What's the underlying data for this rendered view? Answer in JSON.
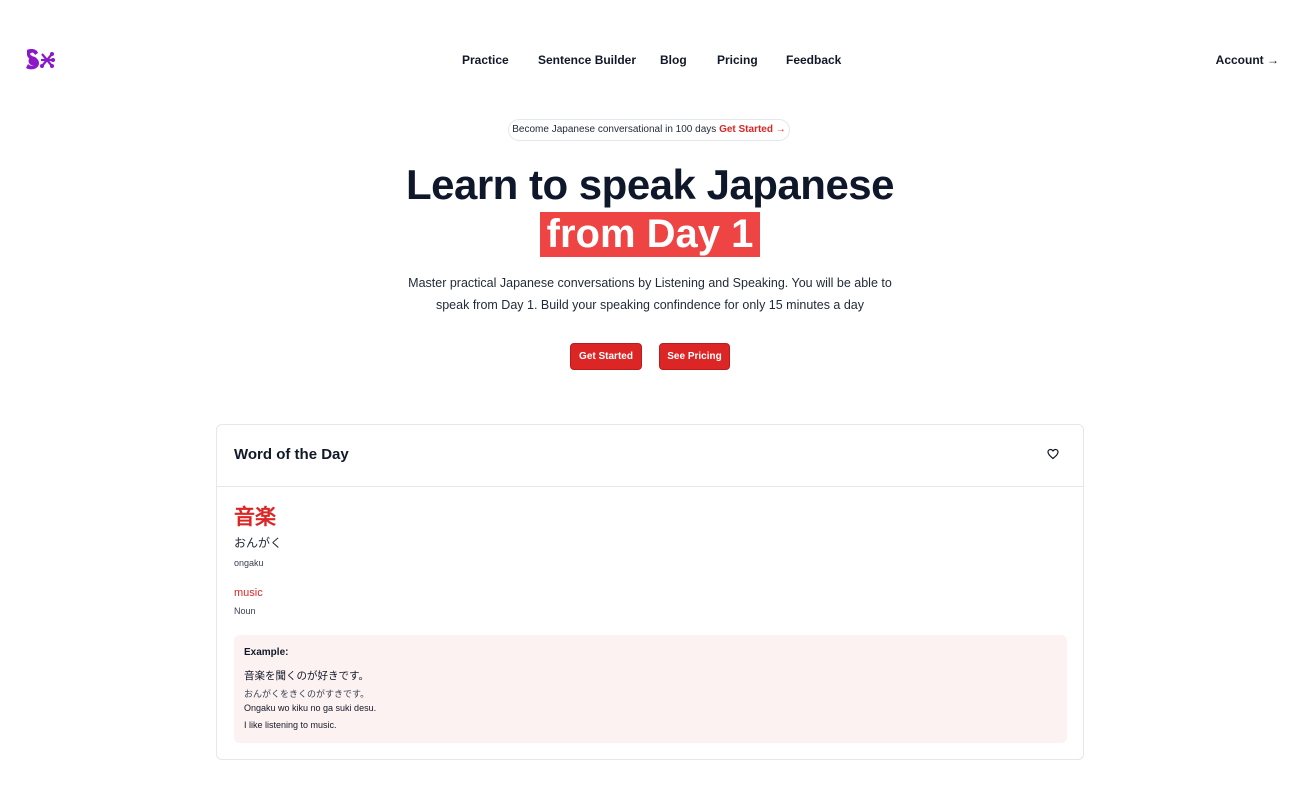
{
  "nav": {
    "links": [
      "Practice",
      "Sentence Builder",
      "Blog",
      "Pricing",
      "Feedback"
    ],
    "account_label": "Account →"
  },
  "brand": {
    "logo_color": "#8b17c9"
  },
  "announcement": {
    "text": "Become Japanese conversational in 100 days",
    "cta": "Get Started →"
  },
  "hero": {
    "title_line1": "Learn to speak Japanese",
    "title_highlight": "from Day 1",
    "subtitle_line1": "Master practical Japanese conversations by Listening and Speaking. You will be able to",
    "subtitle_line2": "speak from Day 1. Build your speaking confindence for only 15 minutes a day",
    "primary_button": "Get Started",
    "secondary_button": "See Pricing"
  },
  "word_of_day": {
    "title": "Word of the Day",
    "kanji": "音楽",
    "kana": "おんがく",
    "romaji": "ongaku",
    "meaning": "music",
    "part_of_speech": "Noun",
    "example": {
      "label": "Example:",
      "japanese": "音楽を聞くのが好きです。",
      "kana": "おんがくをきくのがすきです。",
      "romaji": "Ongaku wo kiku no ga suki desu.",
      "english": "I like listening to music."
    }
  },
  "colors": {
    "accent": "#dc2626",
    "highlight": "#ef4444",
    "example_bg": "#fdf2f2"
  }
}
